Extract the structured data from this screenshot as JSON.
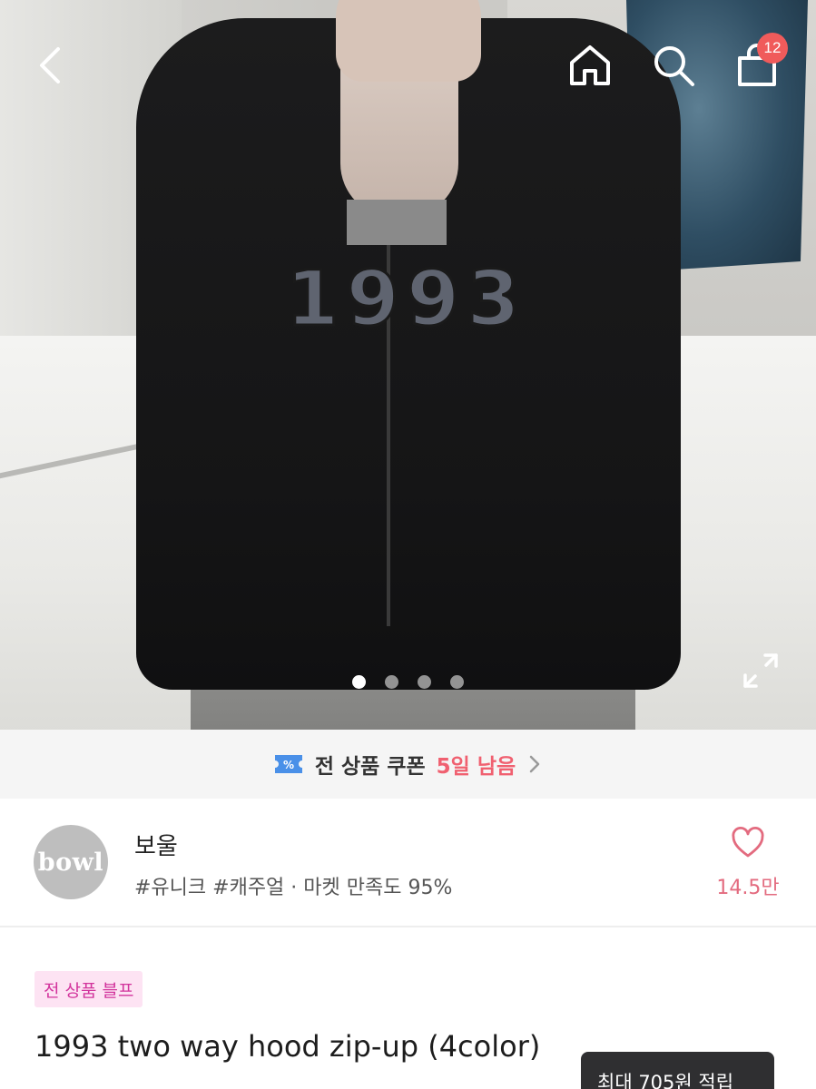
{
  "top_bar": {
    "back_icon": "chevron-left-icon",
    "home_icon": "home-icon",
    "search_icon": "search-icon",
    "cart_icon": "shopping-bag-icon",
    "cart_badge": "12",
    "badge_color": "#f05b5b"
  },
  "gallery": {
    "print_text": "1993",
    "total_slides": 4,
    "active_slide": 1,
    "expand_icon": "expand-icon"
  },
  "coupon_banner": {
    "text": "전 상품 쿠폰",
    "days": "5일 남음",
    "icon": "coupon-ticket-icon",
    "accent_color": "#f06070"
  },
  "shop": {
    "avatar_text": "bowl",
    "name": "보울",
    "meta": "#유니크 #캐주얼 · 마켓 만족도 95%",
    "like_icon": "heart-outline-icon",
    "like_count": "14.5만",
    "like_color": "#e36b7f"
  },
  "product": {
    "tag": "전 상품 블프",
    "title": "1993 two way hood zip-up (4color)",
    "points_tooltip": "최대 705원 적립"
  }
}
